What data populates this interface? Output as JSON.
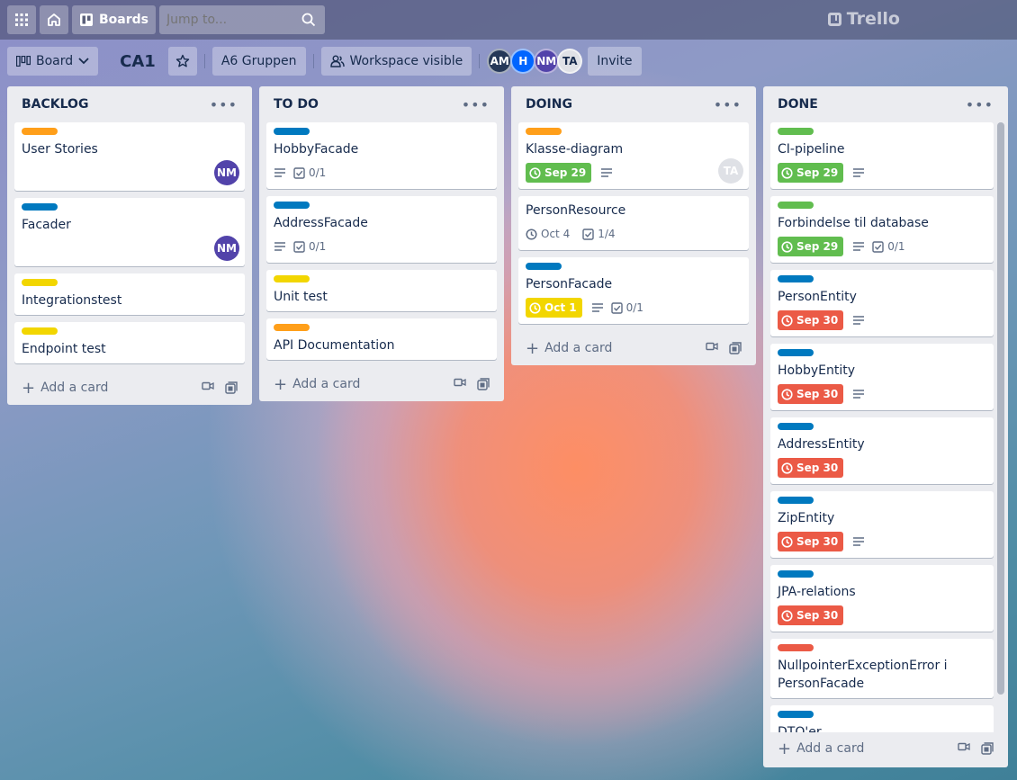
{
  "nav": {
    "apps_icon": "grid-icon",
    "home_icon": "home-icon",
    "boards_label": "Boards",
    "search_placeholder": "Jump to...",
    "logo_text": "Trello"
  },
  "board": {
    "view_label": "Board",
    "title": "CA1",
    "workspace": "A6 Gruppen",
    "visibility": "Workspace visible",
    "members": [
      "AM",
      "H",
      "NM",
      "TA"
    ],
    "invite_label": "Invite"
  },
  "colors": {
    "orange": "#ff9f1a",
    "blue": "#0079bf",
    "yellow": "#f2d600",
    "green": "#61bd4f",
    "red": "#eb5a46"
  },
  "add_card_label": "Add a card",
  "lists": [
    {
      "title": "BACKLOG",
      "cards": [
        {
          "label": "orange",
          "title": "User Stories",
          "member": "NM"
        },
        {
          "label": "blue",
          "title": "Facader",
          "member": "NM"
        },
        {
          "label": "yellow",
          "title": "Integrationstest"
        },
        {
          "label": "yellow",
          "title": "Endpoint test"
        }
      ]
    },
    {
      "title": "TO DO",
      "cards": [
        {
          "label": "blue",
          "title": "HobbyFacade",
          "checklist": "0/1"
        },
        {
          "label": "blue",
          "title": "AddressFacade",
          "checklist": "0/1"
        },
        {
          "label": "yellow",
          "title": "Unit test"
        },
        {
          "label": "orange",
          "title": "API Documentation"
        }
      ]
    },
    {
      "title": "DOING",
      "cards": [
        {
          "label": "orange",
          "title": "Klasse-diagram",
          "due": "Sep 29",
          "member": "TA"
        },
        {
          "title": "PersonResource",
          "due": "Oct 4",
          "checklist": "1/4"
        },
        {
          "label": "blue",
          "title": "PersonFacade",
          "due": "Oct 1",
          "checklist": "0/1"
        }
      ]
    },
    {
      "title": "DONE",
      "cards": [
        {
          "label": "green",
          "title": "CI-pipeline",
          "due": "Sep 29"
        },
        {
          "label": "green",
          "title": "Forbindelse til database",
          "due": "Sep 29",
          "checklist": "0/1"
        },
        {
          "label": "blue",
          "title": "PersonEntity",
          "due": "Sep 30"
        },
        {
          "label": "blue",
          "title": "HobbyEntity",
          "due": "Sep 30"
        },
        {
          "label": "blue",
          "title": "AddressEntity",
          "due": "Sep 30"
        },
        {
          "label": "blue",
          "title": "ZipEntity",
          "due": "Sep 30"
        },
        {
          "label": "blue",
          "title": "JPA-relations",
          "due": "Sep 30"
        },
        {
          "label": "red",
          "title": "NullpointerExceptionError i PersonFacade"
        },
        {
          "label": "blue",
          "title": "DTO'er"
        }
      ]
    }
  ]
}
